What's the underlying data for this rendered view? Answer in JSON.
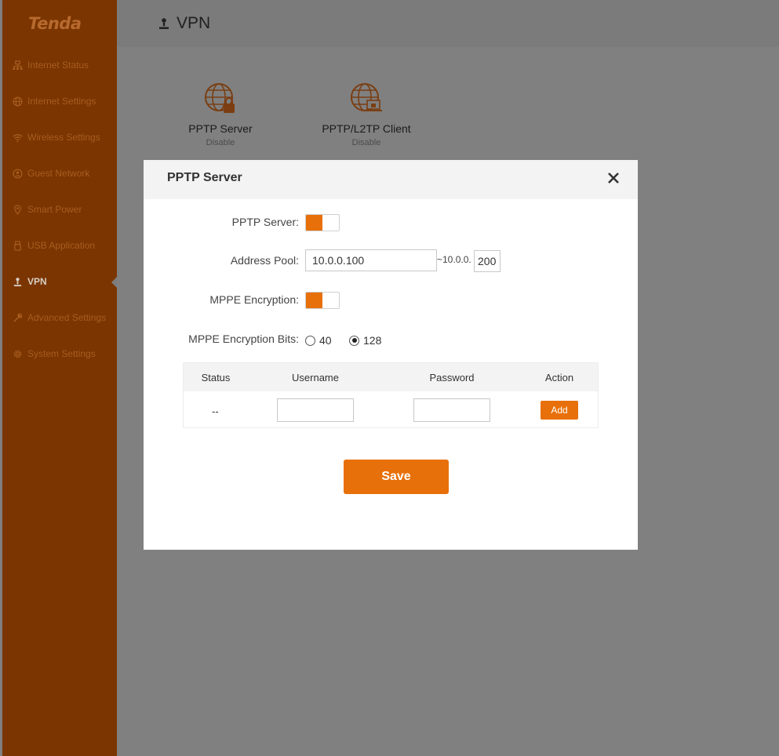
{
  "brand": "Tenda",
  "colors": {
    "accent": "#e8700a",
    "sidebar_bg": "#7a3500",
    "overlay": "#808080"
  },
  "sidebar": {
    "items": [
      {
        "label": "Internet Status",
        "icon": "network-icon"
      },
      {
        "label": "Internet Settings",
        "icon": "globe-icon"
      },
      {
        "label": "Wireless Settings",
        "icon": "wifi-icon"
      },
      {
        "label": "Guest Network",
        "icon": "guest-icon"
      },
      {
        "label": "Smart Power",
        "icon": "power-icon"
      },
      {
        "label": "USB Application",
        "icon": "usb-icon"
      },
      {
        "label": "VPN",
        "icon": "vpn-icon",
        "active": true
      },
      {
        "label": "Advanced Settings",
        "icon": "wrench-icon"
      },
      {
        "label": "System Settings",
        "icon": "gear-icon"
      }
    ]
  },
  "page": {
    "title": "VPN"
  },
  "cards": [
    {
      "label": "PPTP Server",
      "status": "Disable"
    },
    {
      "label": "PPTP/L2TP Client",
      "status": "Disable"
    }
  ],
  "modal": {
    "title": "PPTP Server",
    "pptp_server_label": "PPTP Server:",
    "pptp_server_enabled": true,
    "address_pool_label": "Address Pool:",
    "address_pool_start": "10.0.0.100",
    "address_pool_prefix": "~10.0.0.",
    "address_pool_end": "200",
    "mppe_label": "MPPE Encryption:",
    "mppe_enabled": true,
    "mppe_bits_label": "MPPE Encryption Bits:",
    "mppe_bits_options": [
      "40",
      "128"
    ],
    "mppe_bits_selected": "128",
    "table": {
      "headers": [
        "Status",
        "Username",
        "Password",
        "Action"
      ],
      "row": {
        "status": "--",
        "username": "",
        "password": "",
        "action": "Add"
      }
    },
    "save_label": "Save"
  }
}
